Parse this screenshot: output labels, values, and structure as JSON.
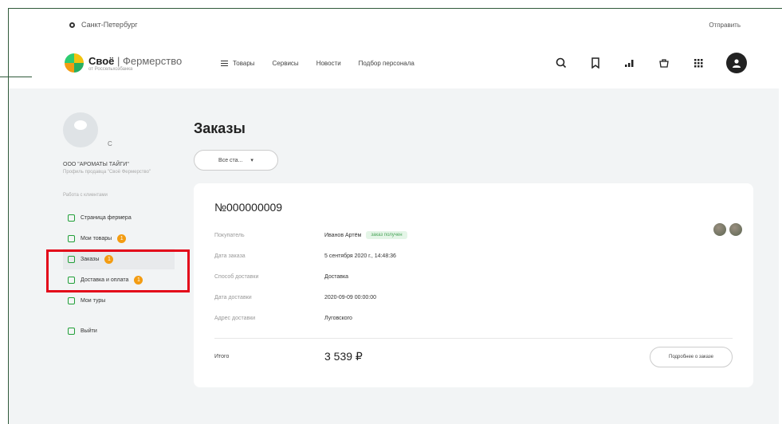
{
  "topbar": {
    "city": "Санкт-Петербург",
    "right_link": "Отправить"
  },
  "header": {
    "brand": "Своё",
    "brand_section": "Фермерство",
    "brand_sub": "от Россельхозбанка",
    "nav": [
      "Товары",
      "Сервисы",
      "Новости",
      "Подбор персонала"
    ],
    "icons": [
      "search-icon",
      "bookmark-icon",
      "chart-icon",
      "basket-icon",
      "grid-icon",
      "user-icon"
    ]
  },
  "sidebar": {
    "avatar_letter": "С",
    "company_name": "ООО \"АРОМАТЫ ТАЙГИ\"",
    "company_sub": "Профиль продавца \"Своё Фермерство\"",
    "section_label": "Работа с клиентами",
    "items": [
      {
        "label": "Страница фермера",
        "badge": ""
      },
      {
        "label": "Мои товары",
        "badge": "1"
      },
      {
        "label": "Заказы",
        "badge": "1"
      },
      {
        "label": "Доставка и оплата",
        "badge": "1"
      },
      {
        "label": "Мои туры",
        "badge": ""
      }
    ],
    "logout": "Выйти"
  },
  "main": {
    "title": "Заказы",
    "filter": "Все ста...",
    "order": {
      "number": "№000000009",
      "rows": [
        {
          "label": "Покупатель",
          "value": "Иванов Артём",
          "tag": "заказ получен"
        },
        {
          "label": "Дата заказа",
          "value": "5 сентября 2020 г., 14:48:36",
          "tag": ""
        },
        {
          "label": "Способ доставки",
          "value": "Доставка",
          "tag": ""
        },
        {
          "label": "Дата доставки",
          "value": "2020-09-09 00:00:00",
          "tag": ""
        },
        {
          "label": "Адрес доставки",
          "value": "Луговского",
          "tag": ""
        }
      ],
      "total_label": "Итого",
      "total_value": "3 539 ₽",
      "details_button": "Подробнее о заказе"
    }
  }
}
